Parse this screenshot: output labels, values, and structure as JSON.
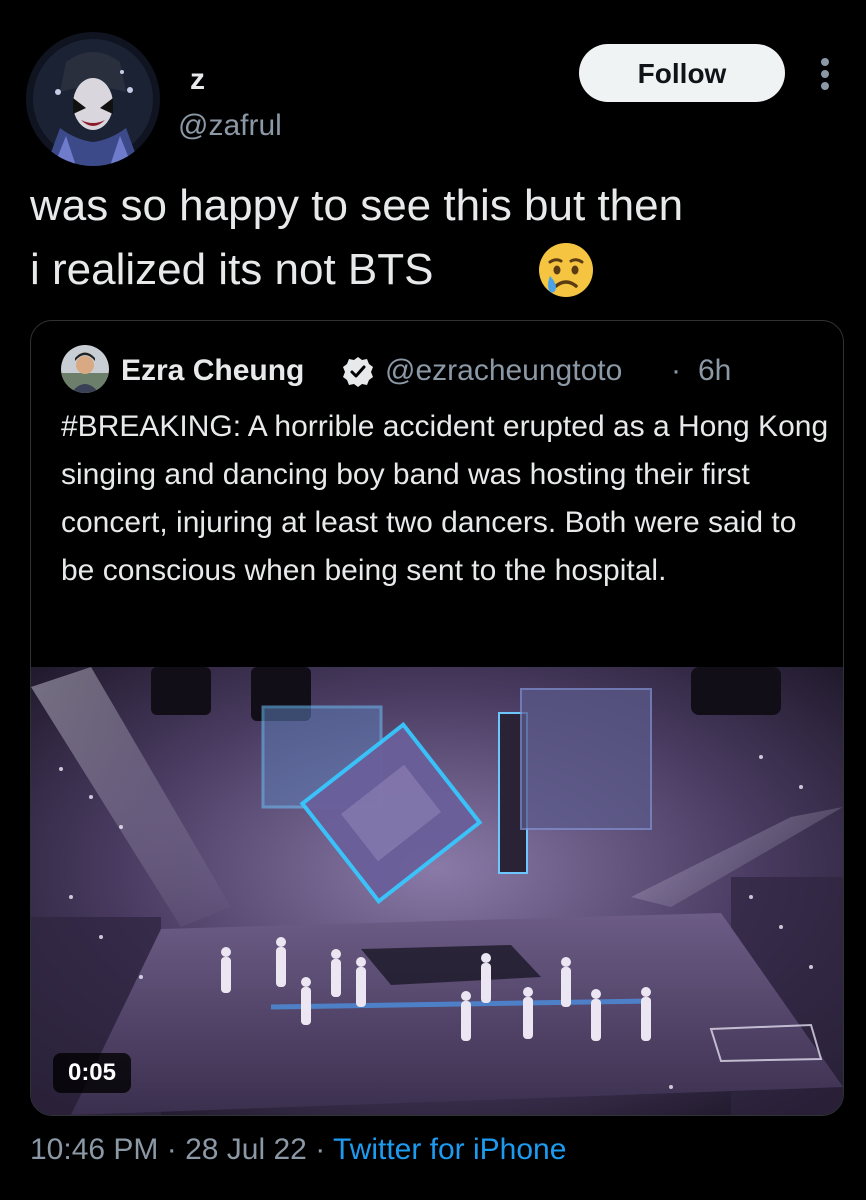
{
  "author": {
    "display_name": "z",
    "handle": "@zafrul",
    "avatar_icon": "profile-photo"
  },
  "follow_label": "Follow",
  "more_icon": "more-vertical-icon",
  "tweet": {
    "text": "was so happy to see this but then\ni realized its not BTS",
    "emoji": "crying-face"
  },
  "quoted": {
    "display_name": "Ezra Cheung",
    "handle": "@ezracheungtoto",
    "separator": "·",
    "time": "6h",
    "text": "#BREAKING: A horrible accident erupted as a Hong Kong singing and dancing boy band was hosting their first concert, injuring at least two dancers. Both were said to be conscious when being sent to the hospital.",
    "verified_icon": "verified-badge-icon",
    "video_duration": "0:05"
  },
  "meta": {
    "time": "10:46 PM",
    "sep": " · ",
    "date": "28 Jul 22",
    "source": "Twitter for iPhone"
  },
  "colors": {
    "background": "#000000",
    "text": "#e7e9ea",
    "muted": "#8b98a5",
    "link": "#1d9bf0",
    "follow_bg": "#eff3f4"
  }
}
